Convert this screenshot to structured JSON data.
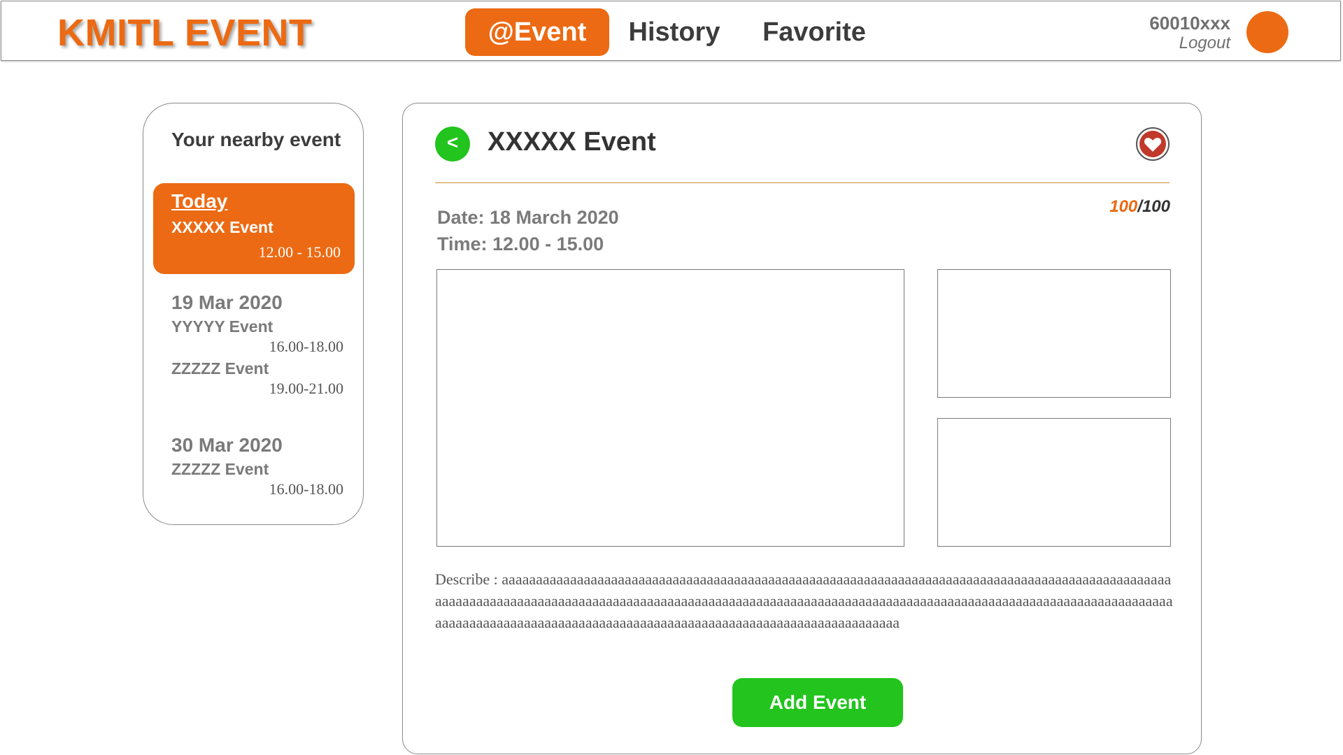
{
  "colors": {
    "accent_orange": "#ec6a13",
    "action_green": "#22c41d",
    "heart_red": "#c0392b",
    "divider": "#d08a3a"
  },
  "header": {
    "logo": "KMITL EVENT",
    "tabs": [
      {
        "label": "@Event",
        "active": true
      },
      {
        "label": "History",
        "active": false
      },
      {
        "label": "Favorite",
        "active": false
      }
    ],
    "user": {
      "id": "60010xxx",
      "logout_label": "Logout",
      "avatar_icon": "user-avatar"
    }
  },
  "sidebar": {
    "title": "Your nearby event",
    "today": {
      "label": "Today",
      "event": "XXXXX Event",
      "time": "12.00 - 15.00"
    },
    "days": [
      {
        "date": "19 Mar 2020",
        "events": [
          {
            "name": "YYYYY Event",
            "time": "16.00-18.00"
          },
          {
            "name": "ZZZZZ Event",
            "time": "19.00-21.00"
          }
        ]
      },
      {
        "date": "30 Mar 2020",
        "events": [
          {
            "name": "ZZZZZ Event",
            "time": "16.00-18.00"
          }
        ]
      }
    ]
  },
  "detail": {
    "back_icon": "chevron-left-icon",
    "back_glyph": "<",
    "title": "XXXXX Event",
    "favorite_icon": "heart-icon",
    "capacity": {
      "current": "100",
      "separator": "/",
      "max": "100"
    },
    "date_line": "Date: 18 March 2020",
    "time_line": "Time: 12.00 - 15.00",
    "describe": "Describe : aaaaaaaaaaaaaaaaaaaaaaaaaaaaaaaaaaaaaaaaaaaaaaaaaaaaaaaaaaaaaaaaaaaaaaaaaaaaaaaaaaaaaaaaaaaaaaaaaaaaaaaaaaaaaaaaaaaaaaaaaaaaaaaaaaaaaaaaaaaaaaaaaaaaaaaaaaaaaaaaaaaaaaaaaaaaaaaaaaaaaaaaaaaaaaaaaaaaaaaaaaaaaaaaaaaaaaaaaaaaaaaaaaaaaaaaaaaaaaaaaaaaaaaaaaaaaaaaaaaaaaaaaaaaaaaaaa",
    "add_button": "Add Event"
  }
}
